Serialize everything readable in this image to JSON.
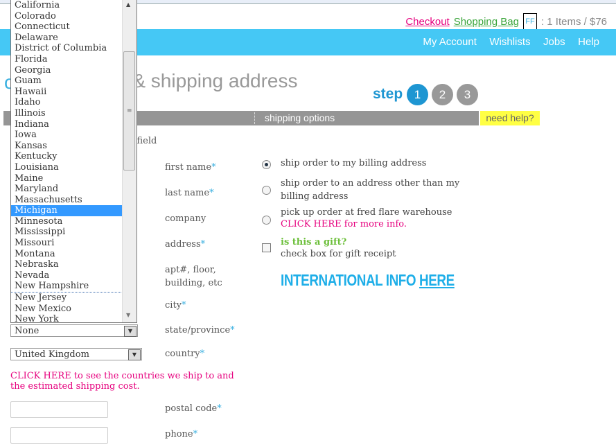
{
  "header": {
    "checkout": "Checkout",
    "shopping_bag": "Shopping Bag",
    "bag_icon_text": "FF",
    "cart_summary": ": 1 Items / $76"
  },
  "nav": {
    "items": [
      "My Account",
      "Wishlists",
      "Jobs",
      "Help"
    ]
  },
  "page": {
    "title_visible": "g & shipping address",
    "title_prefix": "c",
    "step_label": "step",
    "steps": [
      "1",
      "2",
      "3"
    ],
    "tab_shipping": "shipping options",
    "need_help": "need help?",
    "required_note": "d field"
  },
  "form": {
    "labels": {
      "first_name": "first name",
      "last_name": "last name",
      "company": "company",
      "address": "address",
      "apt": "apt#, floor, building, etc",
      "city": "city",
      "state": "state/province",
      "country": "country",
      "postal": "postal code",
      "phone": "phone"
    },
    "required_mark": "*",
    "state_value": "None",
    "country_value": "United Kingdom",
    "countries_link": "CLICK HERE",
    "countries_text": " to see the countries we ship to and the estimated shipping cost."
  },
  "shipping": {
    "opt1": "ship order to my billing address",
    "opt2": "ship order to an address other than my billing address",
    "opt3": "pick up order at fred flare warehouse",
    "opt3_link": "CLICK HERE",
    "opt3_link_text": " for more info.",
    "gift_title": "is this a gift?",
    "gift_sub": "check box for gift receipt",
    "intl": "INTERNATIONAL INFO ",
    "intl_link": "HERE",
    "selected": "opt1"
  },
  "dropdown": {
    "items": [
      "California",
      "Colorado",
      "Connecticut",
      "Delaware",
      "District of Columbia",
      "Florida",
      "Georgia",
      "Guam",
      "Hawaii",
      "Idaho",
      "Illinois",
      "Indiana",
      "Iowa",
      "Kansas",
      "Kentucky",
      "Louisiana",
      "Maine",
      "Maryland",
      "Massachusetts",
      "Michigan",
      "Minnesota",
      "Mississippi",
      "Missouri",
      "Montana",
      "Nebraska",
      "Nevada",
      "New Hampshire",
      "New Jersey",
      "New Mexico",
      "New York"
    ],
    "highlighted": "Michigan"
  },
  "colors": {
    "nav": "#45c8f5",
    "pink": "#e6007e",
    "green": "#3aa53a",
    "step_active": "#1e96d2",
    "step_inactive": "#999999",
    "help_bg": "#ffff44"
  }
}
